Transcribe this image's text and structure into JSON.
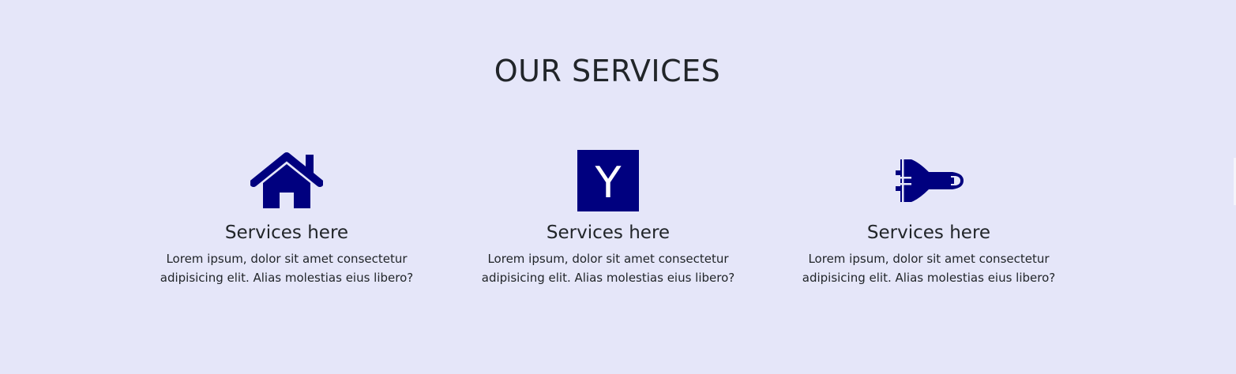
{
  "section": {
    "title": "OUR SERVICES"
  },
  "accent_color": "#00007f",
  "background_color": "#e5e6f9",
  "services": [
    {
      "icon": "home-icon",
      "title": "Services here",
      "description": "Lorem ipsum, dolor sit amet consectetur adipisicing elit. Alias molestias eius libero?"
    },
    {
      "icon": "y-combinator-icon",
      "icon_letter": "Y",
      "title": "Services here",
      "description": "Lorem ipsum, dolor sit amet consectetur adipisicing elit. Alias molestias eius libero?"
    },
    {
      "icon": "space-shuttle-icon",
      "title": "Services here",
      "description": "Lorem ipsum, dolor sit amet consectetur adipisicing elit. Alias molestias eius libero?"
    }
  ]
}
